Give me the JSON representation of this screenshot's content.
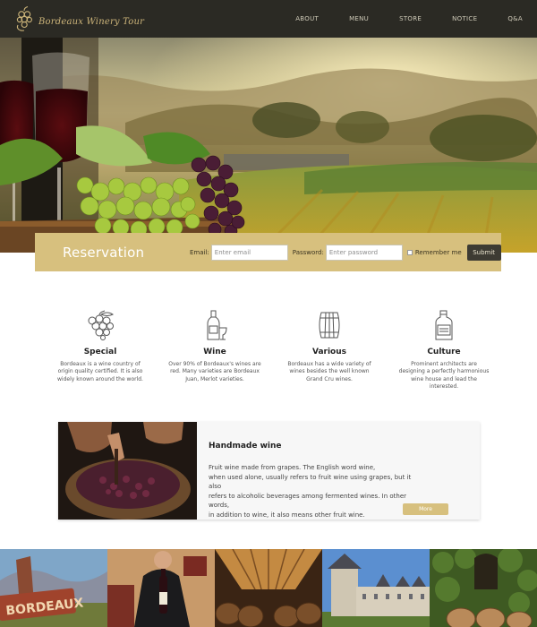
{
  "header": {
    "logo_text": "Bordeaux Winery Tour",
    "nav": [
      {
        "label": "ABOUT"
      },
      {
        "label": "MENU"
      },
      {
        "label": "STORE"
      },
      {
        "label": "NOTICE"
      },
      {
        "label": "Q&A"
      }
    ]
  },
  "reservation": {
    "title": "Reservation",
    "email_label": "Email:",
    "email_placeholder": "Enter email",
    "password_label": "Password:",
    "password_placeholder": "Enter password",
    "remember_label": "Remember me",
    "submit_label": "Submit"
  },
  "features": [
    {
      "title": "Special",
      "icon": "grapes-icon",
      "text": "Bordeaux is a wine country of origin quality certified. It is also widely known around the world."
    },
    {
      "title": "Wine",
      "icon": "wine-bottle-glass-icon",
      "text": "Over 90% of Bordeaux's wines are red. Many varieties are Bordeaux Juan, Merlot varieties."
    },
    {
      "title": "Various",
      "icon": "barrel-icon",
      "text": "Bordeaux has a wide variety of wines besides the well known Grand Cru wines."
    },
    {
      "title": "Culture",
      "icon": "wine-bottle-label-icon",
      "text": "Prominent architects are designing a perfectly harmonious wine house and lead the interested."
    }
  ],
  "handmade": {
    "title": "Handmade wine",
    "lines": [
      "Fruit wine made from grapes. The English word wine,",
      "when used alone, usually refers to fruit wine using grapes, but it also",
      "refers to alcoholic beverages among fermented wines. In other words,",
      "in addition to wine, it also means other fruit wine."
    ],
    "more_label": "More"
  },
  "gallery": {
    "sign_text": "BORDEAUX"
  },
  "colors": {
    "header_bg": "#2b2a24",
    "accent_gold": "#d7c07e",
    "submit_bg": "#3d3b33"
  }
}
